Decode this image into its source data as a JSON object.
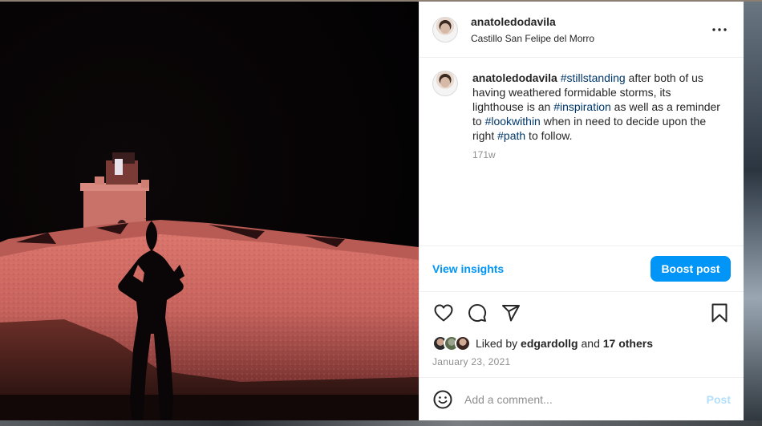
{
  "post": {
    "username": "anatoledodavila",
    "location": "Castillo San Felipe del Morro",
    "more_icon": "more-horizontal-icon",
    "caption": {
      "username": "anatoledodavila",
      "parts": [
        {
          "type": "tag",
          "text": "#stillstanding"
        },
        {
          "type": "text",
          "text": " after both of us having weathered formidable storms, its lighthouse is an "
        },
        {
          "type": "tag",
          "text": "#inspiration"
        },
        {
          "type": "text",
          "text": " as well as a reminder to "
        },
        {
          "type": "tag",
          "text": "#lookwithin"
        },
        {
          "type": "text",
          "text": " when in need to decide upon the right "
        },
        {
          "type": "tag",
          "text": "#path"
        },
        {
          "type": "text",
          "text": " to follow."
        }
      ],
      "age": "171w"
    },
    "insights_label": "View insights",
    "boost_label": "Boost post",
    "likes": {
      "prefix": "Liked by ",
      "first_liker": "edgardollg",
      "middle": " and ",
      "others": "17 others"
    },
    "date": "January 23, 2021",
    "comment": {
      "placeholder": "Add a comment...",
      "post_label": "Post"
    }
  },
  "colors": {
    "accent": "#0095f6",
    "hashtag": "#00376b",
    "muted": "#8e8e8e",
    "post_disabled": "#b2dffc"
  }
}
